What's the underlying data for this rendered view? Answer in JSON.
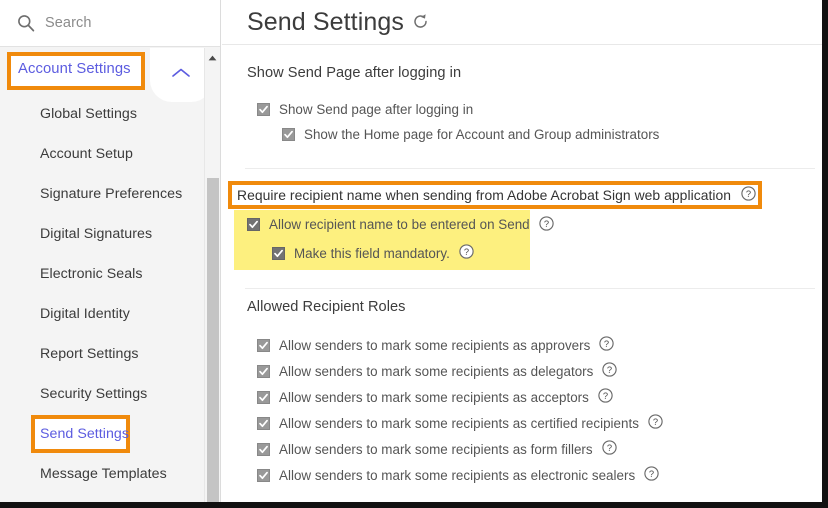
{
  "window": {
    "accent_orange": "#f08a0c",
    "highlight_yellow": "#fdf07f",
    "link_blue": "#5c5ce0"
  },
  "sidebar": {
    "search": {
      "placeholder": "Search",
      "icon": "search-icon"
    },
    "group": {
      "label": "Account Settings",
      "expanded": true,
      "chevron": "chevron-up-icon",
      "highlighted": true
    },
    "items": [
      {
        "label": "Global Settings",
        "highlighted": false
      },
      {
        "label": "Account Setup",
        "highlighted": false
      },
      {
        "label": "Signature Preferences",
        "highlighted": false
      },
      {
        "label": "Digital Signatures",
        "highlighted": false
      },
      {
        "label": "Electronic Seals",
        "highlighted": false
      },
      {
        "label": "Digital Identity",
        "highlighted": false
      },
      {
        "label": "Report Settings",
        "highlighted": false
      },
      {
        "label": "Security Settings",
        "highlighted": false
      },
      {
        "label": "Send Settings",
        "highlighted": true
      },
      {
        "label": "Message Templates",
        "highlighted": false
      }
    ],
    "scrollbar": {
      "arrow_up": "triangle-up-icon"
    }
  },
  "main": {
    "title": "Send Settings",
    "title_icon": "refresh-reset-icon",
    "sections": [
      {
        "heading": "Show Send Page after logging in",
        "highlighted": false,
        "rows": [
          {
            "label": "Show Send page after logging in",
            "checked": true,
            "indent": 1,
            "help": false
          },
          {
            "label": "Show the Home page for Account and Group administrators",
            "checked": true,
            "indent": 2,
            "help": false
          }
        ]
      },
      {
        "heading": "Require recipient name when sending from Adobe Acrobat Sign web application",
        "highlighted": true,
        "heading_help": true,
        "rows": [
          {
            "label": "Allow recipient name to be entered on Send",
            "checked": true,
            "indent": 1,
            "help": true
          },
          {
            "label": "Make this field mandatory.",
            "checked": true,
            "indent": 2,
            "help": true
          }
        ]
      },
      {
        "heading": "Allowed Recipient Roles",
        "highlighted": false,
        "rows": [
          {
            "label": "Allow senders to mark some recipients as approvers",
            "checked": true,
            "indent": 1,
            "help": true
          },
          {
            "label": "Allow senders to mark some recipients as delegators",
            "checked": true,
            "indent": 1,
            "help": true
          },
          {
            "label": "Allow senders to mark some recipients as acceptors",
            "checked": true,
            "indent": 1,
            "help": true
          },
          {
            "label": "Allow senders to mark some recipients as certified recipients",
            "checked": true,
            "indent": 1,
            "help": true
          },
          {
            "label": "Allow senders to mark some recipients as form fillers",
            "checked": true,
            "indent": 1,
            "help": true
          },
          {
            "label": "Allow senders to mark some recipients as electronic sealers",
            "checked": true,
            "indent": 1,
            "help": true
          }
        ]
      }
    ]
  }
}
